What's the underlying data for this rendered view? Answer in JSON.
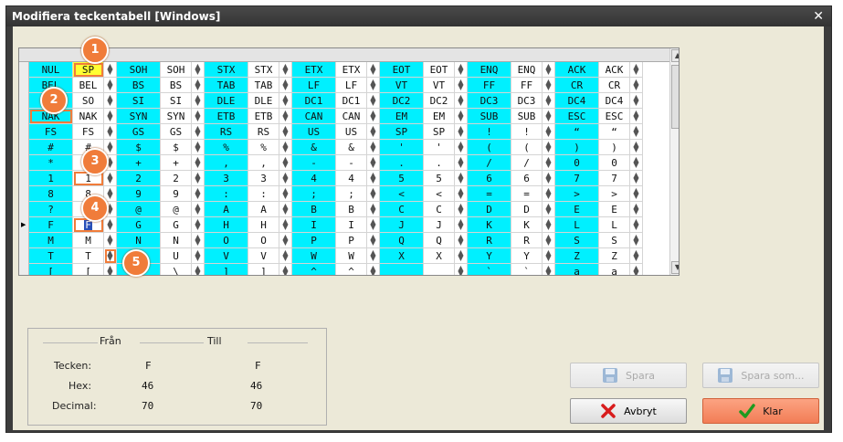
{
  "window": {
    "title": "Modifiera teckentabell [Windows]",
    "close_glyph": "✕"
  },
  "grid": {
    "rows": [
      [
        "NUL",
        "SP",
        "SOH",
        "SOH",
        "STX",
        "STX",
        "ETX",
        "ETX",
        "EOT",
        "EOT",
        "ENQ",
        "ENQ",
        "ACK",
        "ACK"
      ],
      [
        "BEL",
        "BEL",
        "BS",
        "BS",
        "TAB",
        "TAB",
        "LF",
        "LF",
        "VT",
        "VT",
        "FF",
        "FF",
        "CR",
        "CR"
      ],
      [
        "SO",
        "SO",
        "SI",
        "SI",
        "DLE",
        "DLE",
        "DC1",
        "DC1",
        "DC2",
        "DC2",
        "DC3",
        "DC3",
        "DC4",
        "DC4"
      ],
      [
        "NAK",
        "NAK",
        "SYN",
        "SYN",
        "ETB",
        "ETB",
        "CAN",
        "CAN",
        "EM",
        "EM",
        "SUB",
        "SUB",
        "ESC",
        "ESC"
      ],
      [
        "FS",
        "FS",
        "GS",
        "GS",
        "RS",
        "RS",
        "US",
        "US",
        "SP",
        "SP",
        "!",
        "!",
        "“",
        "“"
      ],
      [
        "#",
        "#",
        "$",
        "$",
        "%",
        "%",
        "&",
        "&",
        "'",
        "'",
        "(",
        "(",
        ")",
        ")"
      ],
      [
        "*",
        "*",
        "+",
        "+",
        ",",
        ",",
        "-",
        "-",
        ".",
        ".",
        "/",
        "/",
        "0",
        "0"
      ],
      [
        "1",
        "1",
        "2",
        "2",
        "3",
        "3",
        "4",
        "4",
        "5",
        "5",
        "6",
        "6",
        "7",
        "7"
      ],
      [
        "8",
        "8",
        "9",
        "9",
        ":",
        ":",
        ";",
        ";",
        "<",
        "<",
        "=",
        "=",
        ">",
        ">"
      ],
      [
        "?",
        "?",
        "@",
        "@",
        "A",
        "A",
        "B",
        "B",
        "C",
        "C",
        "D",
        "D",
        "E",
        "E"
      ],
      [
        "F",
        "F",
        "G",
        "G",
        "H",
        "H",
        "I",
        "I",
        "J",
        "J",
        "K",
        "K",
        "L",
        "L"
      ],
      [
        "M",
        "M",
        "N",
        "N",
        "O",
        "O",
        "P",
        "P",
        "Q",
        "Q",
        "R",
        "R",
        "S",
        "S"
      ],
      [
        "T",
        "T",
        "U",
        "U",
        "V",
        "V",
        "W",
        "W",
        "X",
        "X",
        "Y",
        "Y",
        "Z",
        "Z"
      ],
      [
        "[",
        "[",
        "\\",
        "\\",
        "]",
        "]",
        "^",
        "^",
        "_",
        "_",
        "`",
        "`",
        "a",
        "a"
      ]
    ],
    "current_row_marker": "▶"
  },
  "badges": [
    "1",
    "2",
    "3",
    "4",
    "5"
  ],
  "info": {
    "from_label": "Från",
    "to_label": "Till",
    "char_label": "Tecken:",
    "hex_label": "Hex:",
    "dec_label": "Decimal:",
    "from_char": "F",
    "to_char": "F",
    "from_hex": "46",
    "to_hex": "46",
    "from_dec": "70",
    "to_dec": "70"
  },
  "buttons": {
    "save": "Spara",
    "save_as": "Spara som...",
    "cancel": "Avbryt",
    "done": "Klar"
  },
  "colors": {
    "cyan": "#00f0ff",
    "highlight_yellow": "#ffff33",
    "badge_orange": "#f07c3a"
  }
}
